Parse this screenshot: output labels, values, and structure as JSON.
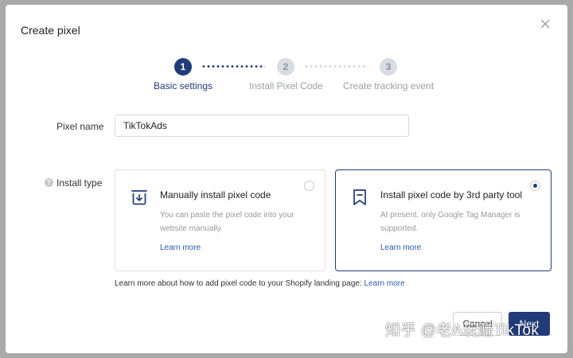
{
  "dialog": {
    "title": "Create pixel"
  },
  "stepper": {
    "steps": [
      {
        "number": "1",
        "label": "Basic settings",
        "state": "active"
      },
      {
        "number": "2",
        "label": "Install Pixel Code",
        "state": "inactive"
      },
      {
        "number": "3",
        "label": "Create tracking event",
        "state": "inactive"
      }
    ]
  },
  "form": {
    "pixel_name_label": "Pixel name",
    "pixel_name_value": "TikTokAds",
    "install_type_label": "Install type",
    "help_icon_glyph": "?"
  },
  "options": [
    {
      "title": "Manually install pixel code",
      "description": "You can paste the pixel code into your website manually.",
      "link": "Learn more",
      "selected": false,
      "icon": "download-icon"
    },
    {
      "title": "Install pixel code by 3rd party tool",
      "description": "At present, only Google Tag Manager is supported.",
      "link": "Learn more",
      "selected": true,
      "icon": "bookmark-icon"
    }
  ],
  "footnote": {
    "text": "Learn more about how to add pixel code to your Shopify landing page: ",
    "link": "Learn more"
  },
  "buttons": {
    "cancel": "Cancel",
    "next": "Next"
  },
  "watermark": "知乎 @老A玩赚TikTok",
  "colors": {
    "accent": "#213b7a",
    "link": "#2b5cab",
    "backdrop": "#a9a9a9"
  }
}
